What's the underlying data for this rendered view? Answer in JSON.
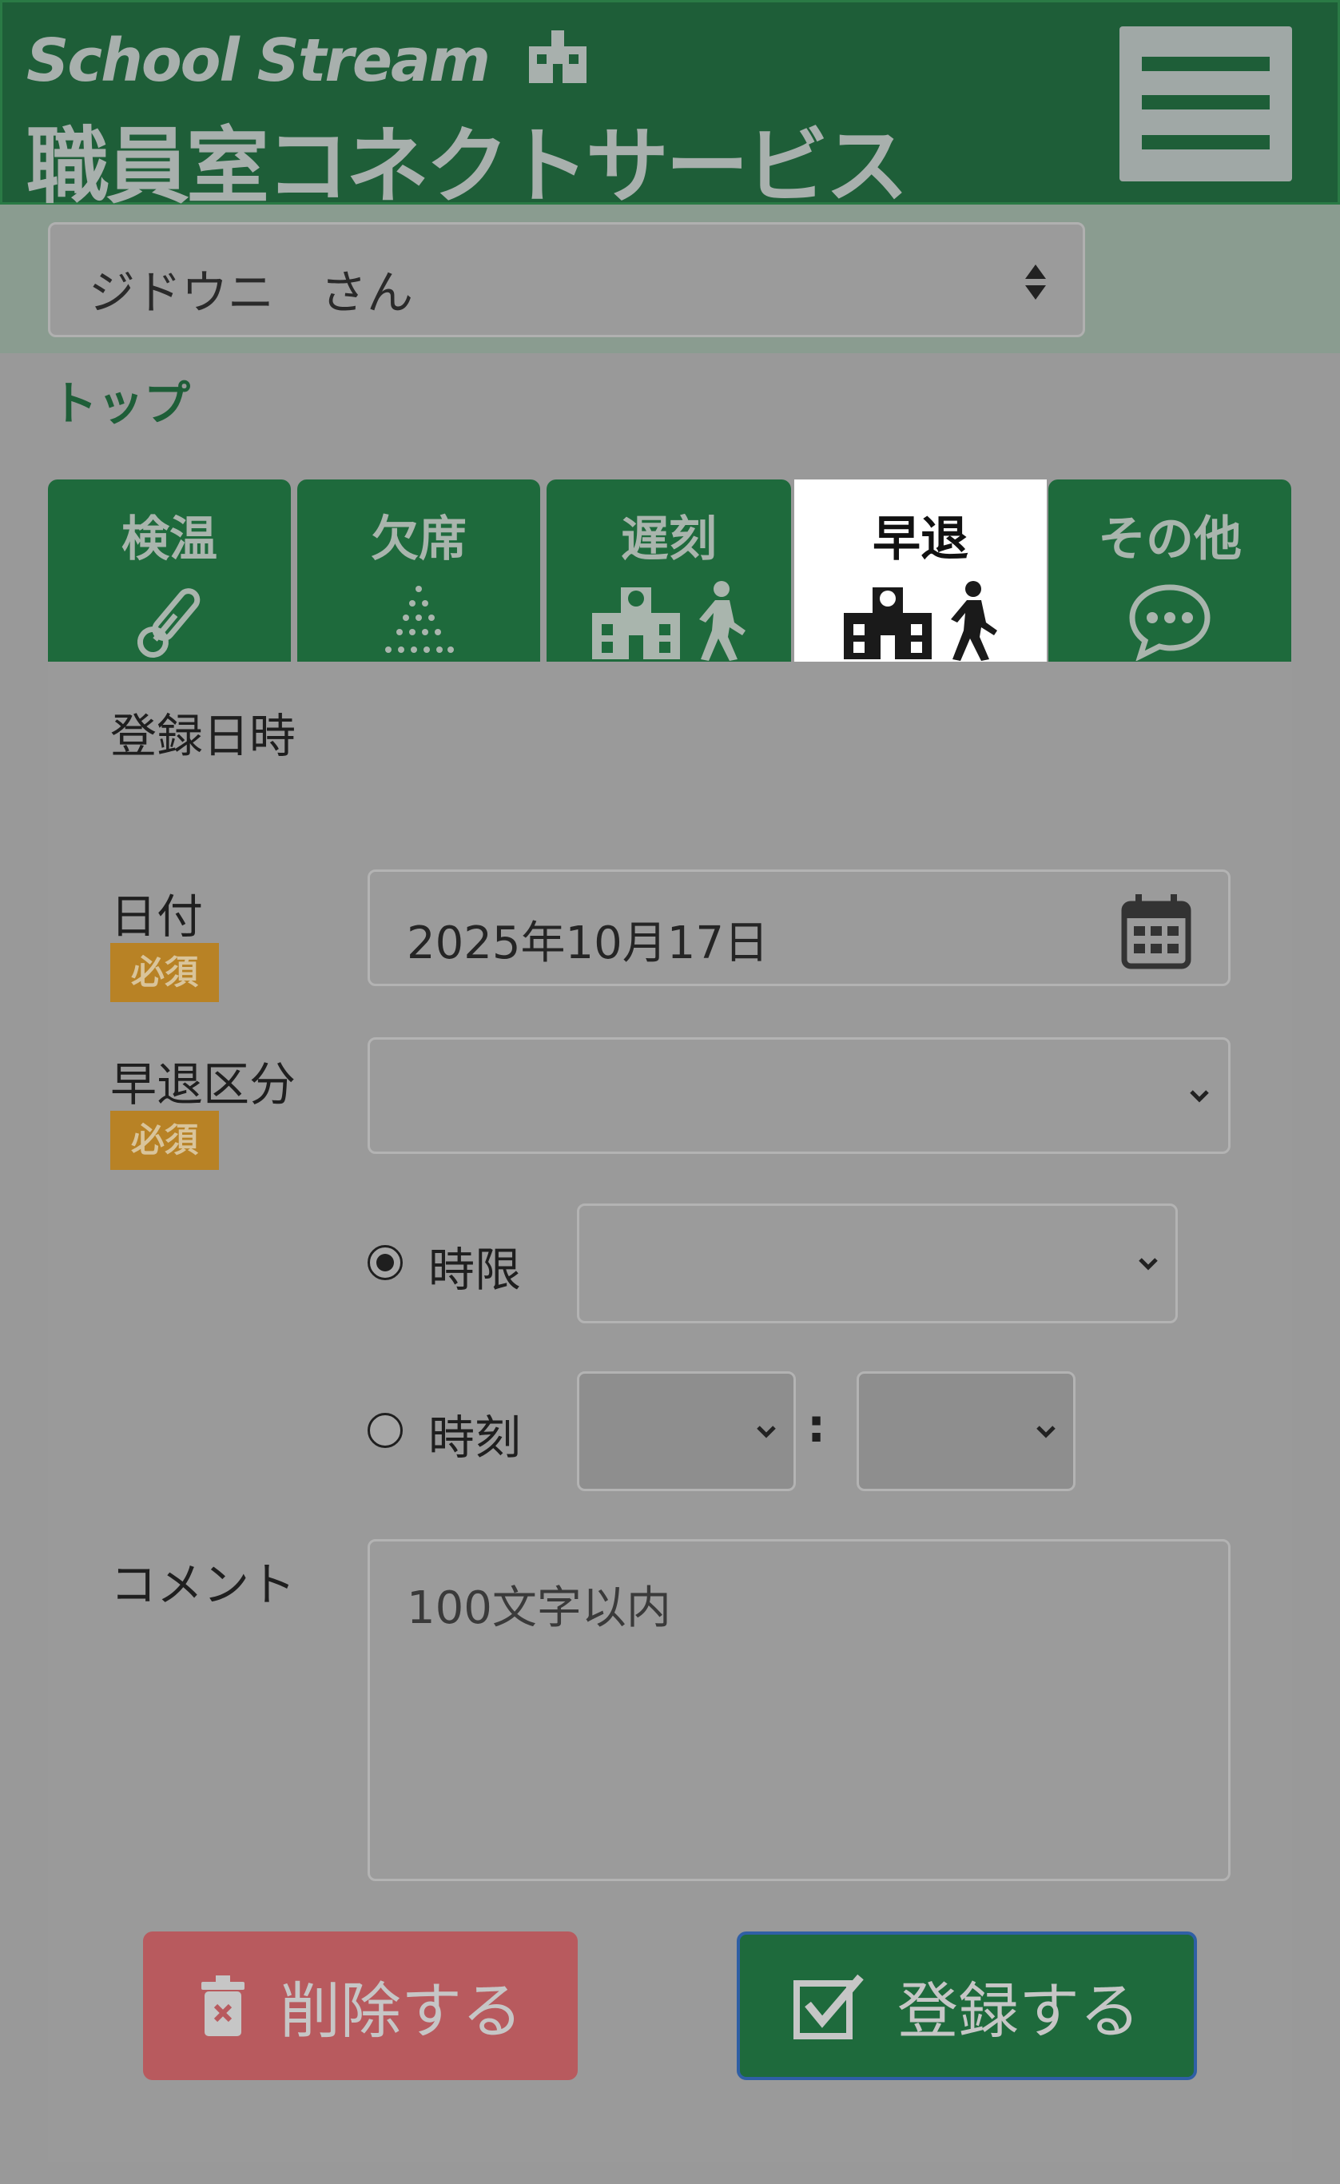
{
  "header": {
    "brand_latin": "School Stream",
    "brand_jp": "職員室コネクトサービス",
    "menu_icon": "hamburger-icon"
  },
  "student_select": {
    "value": "ジドウニ　さん",
    "icon": "sort-updown-icon"
  },
  "breadcrumb": "トップ",
  "tabs": [
    {
      "label": "検温",
      "icon": "thermometer-icon",
      "active": false
    },
    {
      "label": "欠席",
      "icon": "dots-triangle-icon",
      "active": false
    },
    {
      "label": "遅刻",
      "icon": "school-walking-icon",
      "active": false
    },
    {
      "label": "早退",
      "icon": "school-walking-icon",
      "active": true
    },
    {
      "label": "その他",
      "icon": "chat-bubble-icon",
      "active": false
    }
  ],
  "form": {
    "heading": "登録日時",
    "required_badge": "必須",
    "date": {
      "label": "日付",
      "value": "2025年10月17日",
      "icon": "calendar-icon"
    },
    "leave_type": {
      "label": "早退区分",
      "value": ""
    },
    "period": {
      "label": "時限",
      "selected": true,
      "value": ""
    },
    "time": {
      "label": "時刻",
      "selected": false,
      "hour": "",
      "minute": "",
      "separator": ":"
    },
    "comment": {
      "label": "コメント",
      "placeholder": "100文字以内"
    }
  },
  "buttons": {
    "delete": {
      "label": "削除する",
      "icon": "trash-icon"
    },
    "save": {
      "label": "登録する",
      "icon": "check-square-icon"
    }
  },
  "colors": {
    "brand_green": "#1e6a3c",
    "required_badge": "#b88225",
    "delete": "#b85a5e"
  }
}
